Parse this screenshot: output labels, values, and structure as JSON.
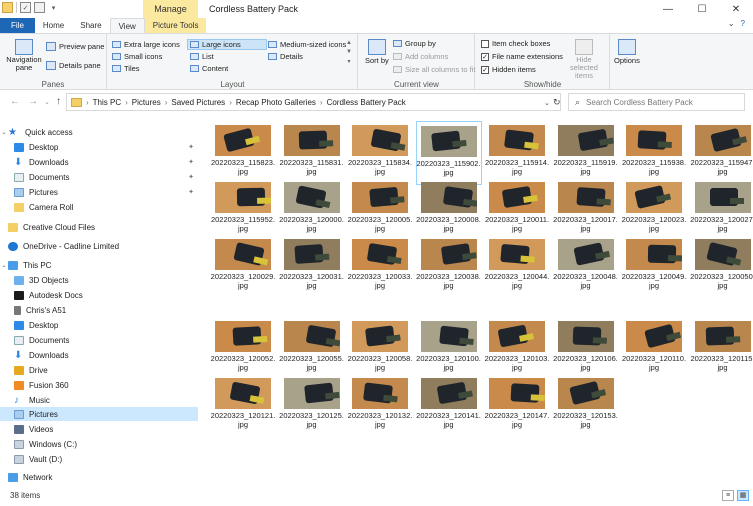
{
  "window": {
    "title": "Cordless Battery Pack",
    "manage_label": "Manage",
    "minimize": "—",
    "maximize": "☐",
    "close": "✕"
  },
  "ribbon_tabs": {
    "file": "File",
    "home": "Home",
    "share": "Share",
    "view": "View",
    "picture_tools": "Picture Tools"
  },
  "ribbon": {
    "panes": {
      "navigation_pane": "Navigation pane",
      "preview_pane": "Preview pane",
      "details_pane": "Details pane",
      "label": "Panes"
    },
    "layout": {
      "extra_large": "Extra large icons",
      "large": "Large icons",
      "medium": "Medium-sized icons",
      "small": "Small icons",
      "list": "List",
      "details": "Details",
      "tiles": "Tiles",
      "content": "Content",
      "label": "Layout"
    },
    "current_view": {
      "sort_by": "Sort by",
      "group_by": "Group by",
      "add_columns": "Add columns",
      "size_columns": "Size all columns to fit",
      "label": "Current view"
    },
    "show_hide": {
      "item_check_boxes": "Item check boxes",
      "file_name_extensions": "File name extensions",
      "hidden_items": "Hidden items",
      "hide_selected": "Hide selected items",
      "label": "Show/hide"
    },
    "options": "Options"
  },
  "address": {
    "crumbs": [
      "This PC",
      "Pictures",
      "Saved Pictures",
      "Recap Photo Galleries",
      "Cordless Battery Pack"
    ],
    "search_placeholder": "Search Cordless Battery Pack"
  },
  "nav_pane": {
    "quick_access": "Quick access",
    "quick_items": [
      "Desktop",
      "Downloads",
      "Documents",
      "Pictures",
      "Camera Roll"
    ],
    "creative_cloud": "Creative Cloud Files",
    "onedrive": "OneDrive - Cadline Limited",
    "this_pc": "This PC",
    "pc_items": [
      "3D Objects",
      "Autodesk Docs",
      "Chris's A51",
      "Desktop",
      "Documents",
      "Downloads",
      "Drive",
      "Fusion 360",
      "Music",
      "Pictures",
      "Videos",
      "Windows (C:)",
      "Vault (D:)"
    ],
    "network": "Network"
  },
  "files": [
    {
      "name": "20220323_115823.",
      "ext": "jpg"
    },
    {
      "name": "20220323_115831.",
      "ext": "jpg"
    },
    {
      "name": "20220323_115834.",
      "ext": "jpg"
    },
    {
      "name": "20220323_115902.",
      "ext": "jpg"
    },
    {
      "name": "20220323_115914.",
      "ext": "jpg"
    },
    {
      "name": "20220323_115919.",
      "ext": "jpg"
    },
    {
      "name": "20220323_115938.",
      "ext": "jpg"
    },
    {
      "name": "20220323_115947.",
      "ext": "jpg"
    },
    {
      "name": "20220323_115952.",
      "ext": "jpg"
    },
    {
      "name": "20220323_120000.",
      "ext": "jpg"
    },
    {
      "name": "20220323_120005.",
      "ext": "jpg"
    },
    {
      "name": "20220323_120008.",
      "ext": "jpg"
    },
    {
      "name": "20220323_120011.",
      "ext": "jpg"
    },
    {
      "name": "20220323_120017.",
      "ext": "jpg"
    },
    {
      "name": "20220323_120023.",
      "ext": "jpg"
    },
    {
      "name": "20220323_120027.",
      "ext": "jpg"
    },
    {
      "name": "20220323_120029.",
      "ext": "jpg"
    },
    {
      "name": "20220323_120031.",
      "ext": "jpg"
    },
    {
      "name": "20220323_120033.",
      "ext": "jpg"
    },
    {
      "name": "20220323_120038.",
      "ext": "jpg"
    },
    {
      "name": "20220323_120044.",
      "ext": "jpg"
    },
    {
      "name": "20220323_120048.",
      "ext": "jpg"
    },
    {
      "name": "20220323_120049.",
      "ext": "jpg"
    },
    {
      "name": "20220323_120050.",
      "ext": "jpg"
    },
    {
      "name": "20220323_120052.",
      "ext": "jpg"
    },
    {
      "name": "20220323_120055.",
      "ext": "jpg"
    },
    {
      "name": "20220323_120058.",
      "ext": "jpg"
    },
    {
      "name": "20220323_120100.",
      "ext": "jpg"
    },
    {
      "name": "20220323_120103.",
      "ext": "jpg"
    },
    {
      "name": "20220323_120106.",
      "ext": "jpg"
    },
    {
      "name": "20220323_120110.",
      "ext": "jpg"
    },
    {
      "name": "20220323_120115.",
      "ext": "jpg"
    },
    {
      "name": "20220323_120121.",
      "ext": "jpg"
    },
    {
      "name": "20220323_120125.",
      "ext": "jpg"
    },
    {
      "name": "20220323_120132.",
      "ext": "jpg"
    },
    {
      "name": "20220323_120141.",
      "ext": "jpg"
    },
    {
      "name": "20220323_120147.",
      "ext": "jpg"
    },
    {
      "name": "20220323_120153.",
      "ext": "jpg"
    }
  ],
  "status": {
    "count": "38 items"
  },
  "colors": {
    "accent": "#1e67b7",
    "manage_tab": "#fbe9a0",
    "selection": "#cce8ff"
  }
}
